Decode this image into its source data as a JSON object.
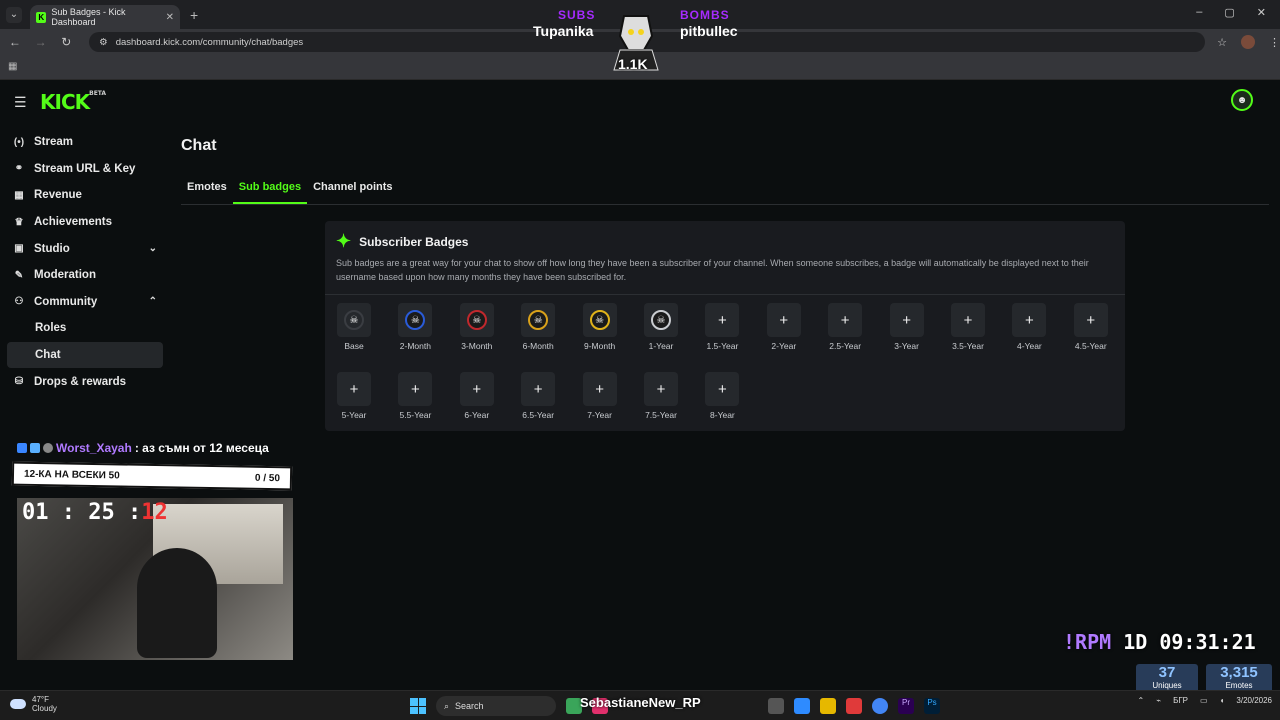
{
  "browser": {
    "tab_title": "Sub Badges - Kick Dashboard",
    "tab_close": "✕",
    "new_tab": "+",
    "url": "dashboard.kick.com/community/chat/badges",
    "window_controls": [
      "–",
      "▢",
      "✕"
    ]
  },
  "stream_overlay": {
    "subs_label": "SUBS",
    "subs_name": "Tupanika",
    "bombs_label": "BOMBS",
    "bombs_name": "pitbullec",
    "mascot_count": "1.1K",
    "chat_user": "Worst_Xayah",
    "chat_message": ": аз съмн от 12 месеца",
    "goal_text": "12-КА НА ВСЕКИ 50",
    "goal_progress": "0 / 50",
    "timer_main": "01 : 25 :",
    "timer_sec": "12",
    "clock_rpm": "!RPM",
    "clock_time": "1D 09:31:21",
    "uniques_value": "37",
    "uniques_label": "Uniques",
    "emotes_value": "3,315",
    "emotes_label": "Emotes"
  },
  "app": {
    "logo": "KICK",
    "logo_tag": "BETA"
  },
  "sidebar": {
    "items": [
      {
        "label": "Stream",
        "icon": "broadcast-icon",
        "glyph": "(•)"
      },
      {
        "label": "Stream URL & Key",
        "icon": "link-icon",
        "glyph": "⚭"
      },
      {
        "label": "Revenue",
        "icon": "revenue-icon",
        "glyph": "▦"
      },
      {
        "label": "Achievements",
        "icon": "trophy-icon",
        "glyph": "♛"
      },
      {
        "label": "Studio",
        "icon": "studio-icon",
        "glyph": "▣"
      },
      {
        "label": "Moderation",
        "icon": "wrench-icon",
        "glyph": "✎"
      },
      {
        "label": "Community",
        "icon": "community-icon",
        "glyph": "⚇"
      },
      {
        "label": "Roles"
      },
      {
        "label": "Chat"
      },
      {
        "label": "Drops & rewards",
        "icon": "drops-icon",
        "glyph": "⛁"
      }
    ]
  },
  "main": {
    "title": "Chat",
    "tabs": [
      "Emotes",
      "Sub badges",
      "Channel points"
    ],
    "active_tab": "Sub badges",
    "card_title": "Subscriber Badges",
    "card_desc": "Sub badges are a great way for your chat to show off how long they have been a subscriber of your channel. When someone subscribes, a badge will automatically be displayed next to their username based upon how many months they have been subscribed for.",
    "badges": [
      {
        "label": "Base",
        "set": true
      },
      {
        "label": "2-Month",
        "set": true
      },
      {
        "label": "3-Month",
        "set": true
      },
      {
        "label": "6-Month",
        "set": true
      },
      {
        "label": "9-Month",
        "set": true
      },
      {
        "label": "1-Year",
        "set": true
      },
      {
        "label": "1.5-Year",
        "set": false
      },
      {
        "label": "2-Year",
        "set": false
      },
      {
        "label": "2.5-Year",
        "set": false
      },
      {
        "label": "3-Year",
        "set": false
      },
      {
        "label": "3.5-Year",
        "set": false
      },
      {
        "label": "4-Year",
        "set": false
      },
      {
        "label": "4.5-Year",
        "set": false
      },
      {
        "label": "5-Year",
        "set": false
      },
      {
        "label": "5.5-Year",
        "set": false
      },
      {
        "label": "6-Year",
        "set": false
      },
      {
        "label": "6.5-Year",
        "set": false
      },
      {
        "label": "7-Year",
        "set": false
      },
      {
        "label": "7.5-Year",
        "set": false
      },
      {
        "label": "8-Year",
        "set": false
      }
    ],
    "add_glyph": "+"
  },
  "taskbar": {
    "temp": "47°F",
    "condition": "Cloudy",
    "search": "Search",
    "handle": "SebastianeNew_RP",
    "lang": "БГР",
    "date": "3/20/2026"
  },
  "colors": {
    "accent": "#53fc18",
    "bg": "#0b0e0f",
    "card": "#191b1f",
    "tile": "#25282c"
  }
}
